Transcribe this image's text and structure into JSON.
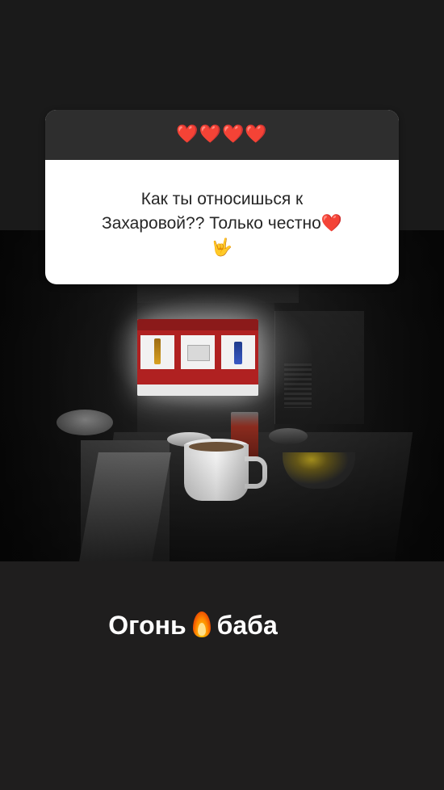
{
  "question": {
    "header_emoji": "❤️❤️❤️❤️",
    "text_line1": "Как ты относишься к",
    "text_line2": "Захаровой?? Только честно",
    "text_heart": "❤️",
    "text_emoji": "🤟"
  },
  "answer": {
    "text_before": "Огонь",
    "emoji": "fire-icon",
    "text_after": "баба"
  },
  "colors": {
    "background": "#1c1c1c",
    "card": "#ffffff",
    "card_header": "#2e2e2e",
    "heart": "#e0203a"
  }
}
